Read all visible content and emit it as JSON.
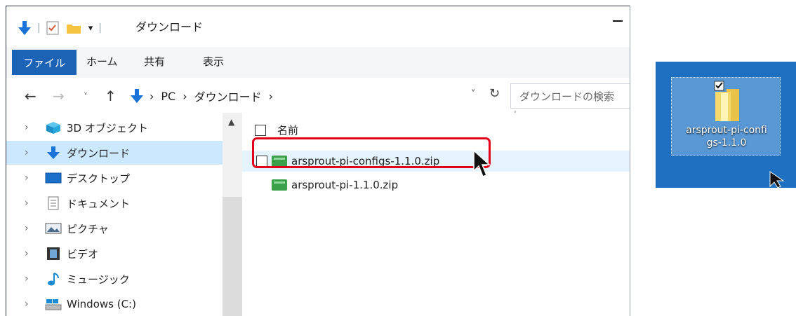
{
  "explorer": {
    "title": "ダウンロード",
    "ribbon_tabs": [
      "ファイル",
      "ホーム",
      "共有",
      "表示"
    ],
    "breadcrumb": [
      "PC",
      "›",
      "ダウンロード",
      "›"
    ],
    "search_placeholder": "ダウンロードの検索",
    "column_header": "名前",
    "nav_items": [
      {
        "label": "3D オブジェクト",
        "icon": "3d-objects-icon"
      },
      {
        "label": "ダウンロード",
        "icon": "download-arrow-icon"
      },
      {
        "label": "デスクトップ",
        "icon": "desktop-icon"
      },
      {
        "label": "ドキュメント",
        "icon": "document-icon"
      },
      {
        "label": "ピクチャ",
        "icon": "pictures-icon"
      },
      {
        "label": "ビデオ",
        "icon": "video-icon"
      },
      {
        "label": "ミュージック",
        "icon": "music-icon"
      },
      {
        "label": "Windows (C:)",
        "icon": "drive-icon"
      }
    ],
    "files": [
      {
        "name": "arsprout-pi-configs-1.1.0.zip",
        "icon": "zip-folder-icon"
      },
      {
        "name": "arsprout-pi-1.1.0.zip",
        "icon": "zip-folder-icon"
      }
    ]
  },
  "desktop": {
    "icon_label_line1": "arsprout-pi-confi",
    "icon_label_line2": "gs-1.1.0",
    "icon": "folder-icon"
  },
  "colors": {
    "accent": "#1c63b5",
    "highlight_border": "#e2001a",
    "selected_nav": "#cce8ff",
    "desktop_bg": "#1e6fc0"
  }
}
